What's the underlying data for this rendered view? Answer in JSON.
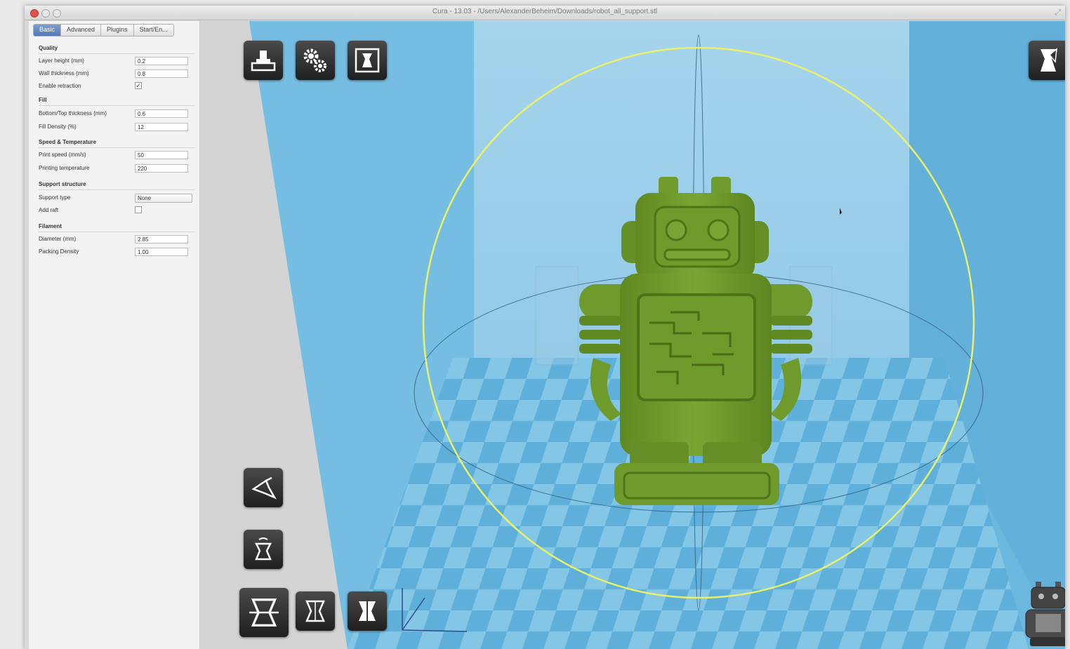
{
  "window": {
    "title": "Cura - 13.03 - /Users/AlexanderBeheim/Downloads/robot_all_support.stl"
  },
  "tabs": [
    {
      "label": "Basic",
      "active": true
    },
    {
      "label": "Advanced",
      "active": false
    },
    {
      "label": "Plugins",
      "active": false
    },
    {
      "label": "Start/En...",
      "active": false
    }
  ],
  "settings": {
    "quality": {
      "heading": "Quality",
      "layer_height": {
        "label": "Layer height (mm)",
        "value": "0.2"
      },
      "wall_thickness": {
        "label": "Wall thickness (mm)",
        "value": "0.8"
      },
      "enable_retraction": {
        "label": "Enable retraction",
        "checked": true
      }
    },
    "fill": {
      "heading": "Fill",
      "bottom_top": {
        "label": "Bottom/Top thickness (mm)",
        "value": "0.6"
      },
      "fill_density": {
        "label": "Fill Density (%)",
        "value": "12"
      }
    },
    "speed": {
      "heading": "Speed & Temperature",
      "print_speed": {
        "label": "Print speed (mm/s)",
        "value": "50"
      },
      "temperature": {
        "label": "Printing temperature",
        "value": "220"
      }
    },
    "support": {
      "heading": "Support structure",
      "support_type": {
        "label": "Support type",
        "value": "None"
      },
      "add_raft": {
        "label": "Add raft",
        "checked": false
      }
    },
    "filament": {
      "heading": "Filament",
      "diameter": {
        "label": "Diameter (mm)",
        "value": "2.85"
      },
      "packing_density": {
        "label": "Packing Density",
        "value": "1.00"
      }
    }
  },
  "toolbar": {
    "top": [
      {
        "name": "load-model",
        "icon": "load-icon"
      },
      {
        "name": "print-settings",
        "icon": "gear-icon"
      },
      {
        "name": "print",
        "icon": "print-icon"
      }
    ],
    "view_mode": {
      "icon": "view-mode-icon"
    },
    "left_tools": [
      {
        "name": "rotate",
        "icon": "rotate-icon"
      },
      {
        "name": "scale",
        "icon": "scale-icon"
      },
      {
        "name": "mirror-x",
        "icon": "mirror-x-icon"
      },
      {
        "name": "mirror-y",
        "icon": "mirror-y-icon"
      },
      {
        "name": "mirror-z",
        "icon": "mirror-z-icon"
      }
    ]
  },
  "colors": {
    "viewport_bg": "#6bb8de",
    "model": "#6f9a2c",
    "rotate_ring": "#e9f06a",
    "checker_light": "#8ccbe8",
    "checker_dark": "#5aaed8"
  }
}
